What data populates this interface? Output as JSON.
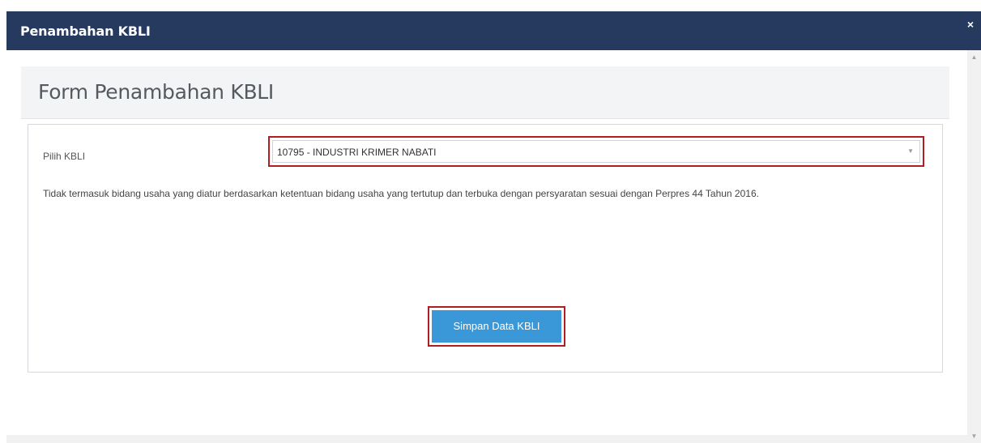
{
  "modal": {
    "title": "Penambahan KBLI",
    "close_icon": "×"
  },
  "form": {
    "heading": "Form Penambahan KBLI",
    "kbli_label": "Pilih KBLI",
    "kbli_selected": "10795 - INDUSTRI KRIMER NABATI",
    "caret_icon": "▼",
    "info_text": "Tidak termasuk bidang usaha yang diatur berdasarkan ketentuan bidang usaha yang tertutup dan terbuka dengan persyaratan sesuai dengan Perpres 44 Tahun 2016.",
    "save_label": "Simpan Data KBLI"
  },
  "scrollbar": {
    "up_icon": "▲",
    "down_icon": "▼"
  },
  "colors": {
    "header_bg": "#253a5e",
    "highlight_border": "#b01e23",
    "button_bg": "#3b98d8"
  }
}
